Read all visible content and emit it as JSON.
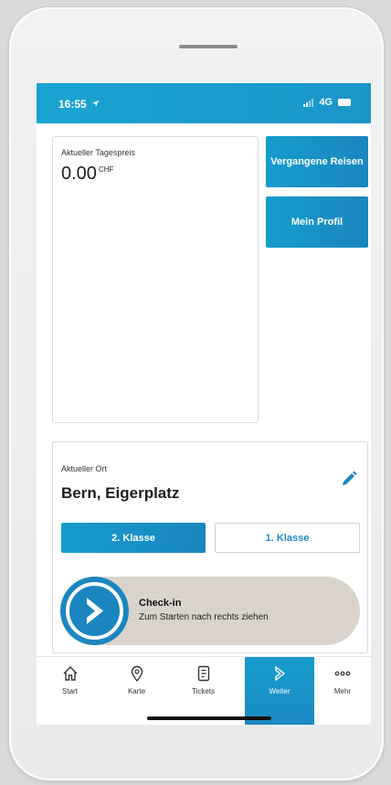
{
  "status_bar": {
    "time": "16:55",
    "network": "4G"
  },
  "price_card": {
    "label": "Aktueller Tagespreis",
    "value": "0.00",
    "unit": "CHF"
  },
  "buttons": {
    "past_trips": "Vergangene Reisen",
    "profile": "Mein Profil"
  },
  "location_card": {
    "label": "Aktueller Ort",
    "name": "Bern, Eigerplatz",
    "class_2": "2. Klasse",
    "class_1": "1. Klasse",
    "selected_class": "2. Klasse"
  },
  "checkin": {
    "title": "Check-in",
    "subtitle": "Zum Starten nach rechts ziehen"
  },
  "tabbar": {
    "items": [
      {
        "label": "Start",
        "icon": "home-icon"
      },
      {
        "label": "Karte",
        "icon": "map-pin-icon"
      },
      {
        "label": "Tickets",
        "icon": "ticket-icon"
      },
      {
        "label": "Weiter",
        "icon": "weiter-icon",
        "active": true
      },
      {
        "label": "Mehr",
        "icon": "more-icon"
      }
    ]
  },
  "colors": {
    "accent": "#1a9acb",
    "accent_dark": "#1b86bf",
    "slider_bg": "#d9d3cc"
  }
}
